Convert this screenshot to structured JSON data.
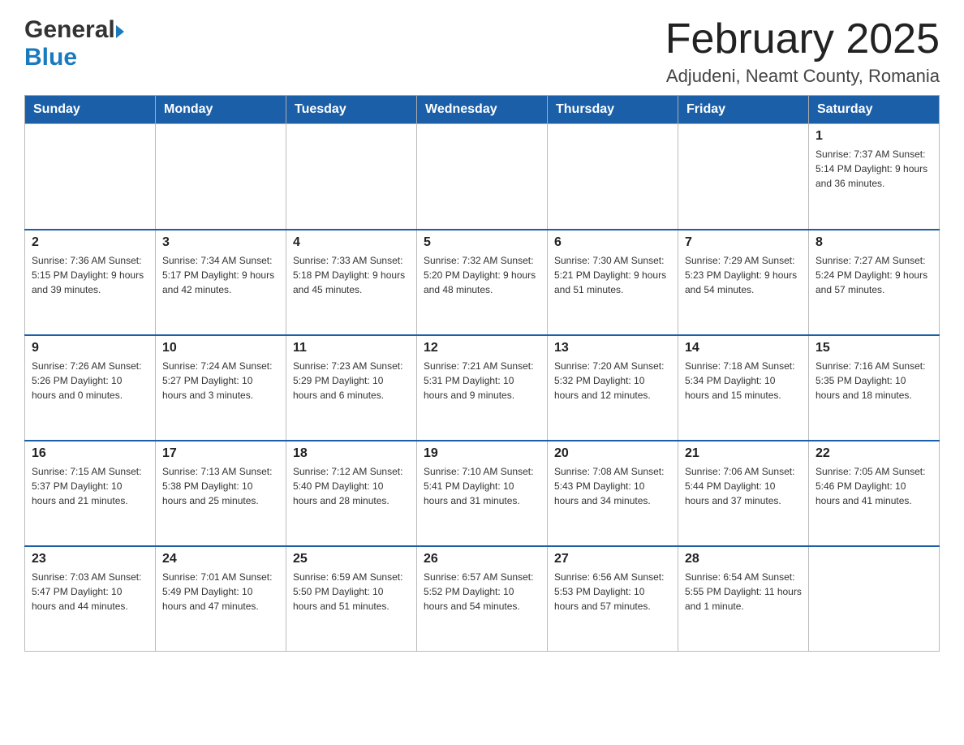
{
  "header": {
    "logo_general": "General",
    "logo_blue": "Blue",
    "month_title": "February 2025",
    "location": "Adjudeni, Neamt County, Romania"
  },
  "weekdays": [
    "Sunday",
    "Monday",
    "Tuesday",
    "Wednesday",
    "Thursday",
    "Friday",
    "Saturday"
  ],
  "weeks": [
    [
      {
        "day": "",
        "info": ""
      },
      {
        "day": "",
        "info": ""
      },
      {
        "day": "",
        "info": ""
      },
      {
        "day": "",
        "info": ""
      },
      {
        "day": "",
        "info": ""
      },
      {
        "day": "",
        "info": ""
      },
      {
        "day": "1",
        "info": "Sunrise: 7:37 AM\nSunset: 5:14 PM\nDaylight: 9 hours\nand 36 minutes."
      }
    ],
    [
      {
        "day": "2",
        "info": "Sunrise: 7:36 AM\nSunset: 5:15 PM\nDaylight: 9 hours\nand 39 minutes."
      },
      {
        "day": "3",
        "info": "Sunrise: 7:34 AM\nSunset: 5:17 PM\nDaylight: 9 hours\nand 42 minutes."
      },
      {
        "day": "4",
        "info": "Sunrise: 7:33 AM\nSunset: 5:18 PM\nDaylight: 9 hours\nand 45 minutes."
      },
      {
        "day": "5",
        "info": "Sunrise: 7:32 AM\nSunset: 5:20 PM\nDaylight: 9 hours\nand 48 minutes."
      },
      {
        "day": "6",
        "info": "Sunrise: 7:30 AM\nSunset: 5:21 PM\nDaylight: 9 hours\nand 51 minutes."
      },
      {
        "day": "7",
        "info": "Sunrise: 7:29 AM\nSunset: 5:23 PM\nDaylight: 9 hours\nand 54 minutes."
      },
      {
        "day": "8",
        "info": "Sunrise: 7:27 AM\nSunset: 5:24 PM\nDaylight: 9 hours\nand 57 minutes."
      }
    ],
    [
      {
        "day": "9",
        "info": "Sunrise: 7:26 AM\nSunset: 5:26 PM\nDaylight: 10 hours\nand 0 minutes."
      },
      {
        "day": "10",
        "info": "Sunrise: 7:24 AM\nSunset: 5:27 PM\nDaylight: 10 hours\nand 3 minutes."
      },
      {
        "day": "11",
        "info": "Sunrise: 7:23 AM\nSunset: 5:29 PM\nDaylight: 10 hours\nand 6 minutes."
      },
      {
        "day": "12",
        "info": "Sunrise: 7:21 AM\nSunset: 5:31 PM\nDaylight: 10 hours\nand 9 minutes."
      },
      {
        "day": "13",
        "info": "Sunrise: 7:20 AM\nSunset: 5:32 PM\nDaylight: 10 hours\nand 12 minutes."
      },
      {
        "day": "14",
        "info": "Sunrise: 7:18 AM\nSunset: 5:34 PM\nDaylight: 10 hours\nand 15 minutes."
      },
      {
        "day": "15",
        "info": "Sunrise: 7:16 AM\nSunset: 5:35 PM\nDaylight: 10 hours\nand 18 minutes."
      }
    ],
    [
      {
        "day": "16",
        "info": "Sunrise: 7:15 AM\nSunset: 5:37 PM\nDaylight: 10 hours\nand 21 minutes."
      },
      {
        "day": "17",
        "info": "Sunrise: 7:13 AM\nSunset: 5:38 PM\nDaylight: 10 hours\nand 25 minutes."
      },
      {
        "day": "18",
        "info": "Sunrise: 7:12 AM\nSunset: 5:40 PM\nDaylight: 10 hours\nand 28 minutes."
      },
      {
        "day": "19",
        "info": "Sunrise: 7:10 AM\nSunset: 5:41 PM\nDaylight: 10 hours\nand 31 minutes."
      },
      {
        "day": "20",
        "info": "Sunrise: 7:08 AM\nSunset: 5:43 PM\nDaylight: 10 hours\nand 34 minutes."
      },
      {
        "day": "21",
        "info": "Sunrise: 7:06 AM\nSunset: 5:44 PM\nDaylight: 10 hours\nand 37 minutes."
      },
      {
        "day": "22",
        "info": "Sunrise: 7:05 AM\nSunset: 5:46 PM\nDaylight: 10 hours\nand 41 minutes."
      }
    ],
    [
      {
        "day": "23",
        "info": "Sunrise: 7:03 AM\nSunset: 5:47 PM\nDaylight: 10 hours\nand 44 minutes."
      },
      {
        "day": "24",
        "info": "Sunrise: 7:01 AM\nSunset: 5:49 PM\nDaylight: 10 hours\nand 47 minutes."
      },
      {
        "day": "25",
        "info": "Sunrise: 6:59 AM\nSunset: 5:50 PM\nDaylight: 10 hours\nand 51 minutes."
      },
      {
        "day": "26",
        "info": "Sunrise: 6:57 AM\nSunset: 5:52 PM\nDaylight: 10 hours\nand 54 minutes."
      },
      {
        "day": "27",
        "info": "Sunrise: 6:56 AM\nSunset: 5:53 PM\nDaylight: 10 hours\nand 57 minutes."
      },
      {
        "day": "28",
        "info": "Sunrise: 6:54 AM\nSunset: 5:55 PM\nDaylight: 11 hours\nand 1 minute."
      },
      {
        "day": "",
        "info": ""
      }
    ]
  ]
}
